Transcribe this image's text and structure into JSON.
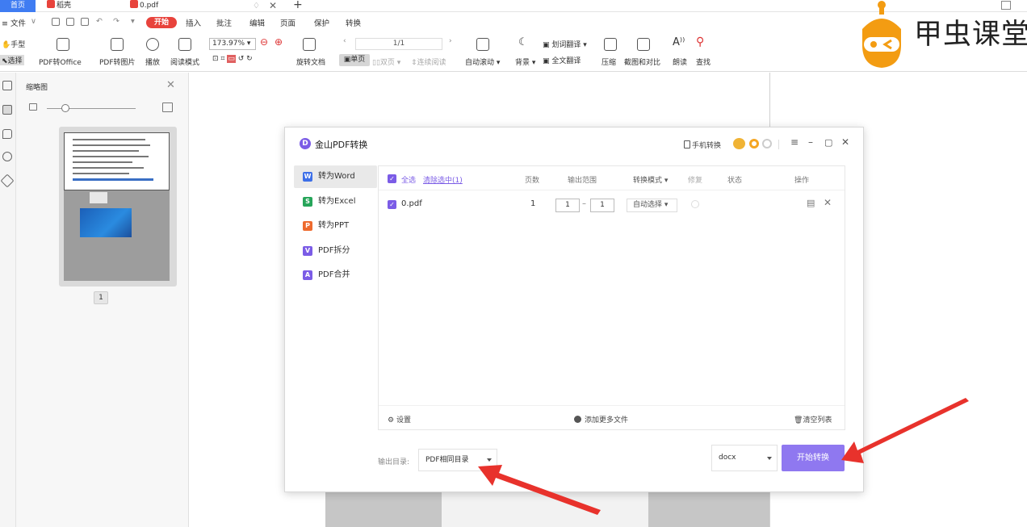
{
  "tabs": {
    "home": "首页",
    "daoke": "稻壳",
    "doc": "0.pdf"
  },
  "menu": {
    "file": "≡ 文件",
    "start": "开始",
    "items": [
      "插入",
      "批注",
      "编辑",
      "页面",
      "保护",
      "转换"
    ]
  },
  "ribbon": {
    "hand": "手型",
    "select": "选择",
    "pdf_to_office": "PDF转Office",
    "pdf_to_image": "PDF转图片",
    "play": "播放",
    "read_mode": "阅读模式",
    "zoom": "173.97%",
    "rotate": "旋转文档",
    "page_indicator": "1/1",
    "single_page": "单页",
    "double_page": "双页",
    "continuous": "连续阅读",
    "auto_scroll": "自动滚动",
    "background": "背景",
    "word_translate": "划词翻译",
    "full_translate": "全文翻译",
    "compress": "压缩",
    "screenshot_compare": "截图和对比",
    "read_aloud": "朗读",
    "find": "查找"
  },
  "logo": {
    "text": "甲虫课堂"
  },
  "thumbnail": {
    "title": "缩略图",
    "page_number": "1"
  },
  "dialog": {
    "title": "金山PDF转换",
    "phone_convert": "手机转换",
    "sidebar": [
      {
        "label": "转为Word",
        "icon": "W",
        "color": "#3d6fe8"
      },
      {
        "label": "转为Excel",
        "icon": "S",
        "color": "#27a55a"
      },
      {
        "label": "转为PPT",
        "icon": "P",
        "color": "#ee6a2e"
      },
      {
        "label": "PDF拆分",
        "icon": "V",
        "color": "#7b5ce6"
      },
      {
        "label": "PDF合并",
        "icon": "A",
        "color": "#7b5ce6"
      }
    ],
    "table": {
      "select_all": "全选",
      "clear_selected": "清除选中(1)",
      "headers": {
        "pages": "页数",
        "range": "输出范围",
        "mode": "转换模式 ▾",
        "repair": "修复",
        "status": "状态",
        "action": "操作"
      },
      "rows": [
        {
          "name": "0.pdf",
          "pages": "1",
          "range_from": "1",
          "range_to": "1",
          "mode": "自动选择 ▾"
        }
      ]
    },
    "footer": {
      "settings": "设置",
      "add_more": "添加更多文件",
      "clear_list": "清空列表"
    },
    "output_dir_label": "输出目录:",
    "output_dir_value": "PDF相同目录",
    "format_value": "docx",
    "start_button": "开始转换"
  },
  "colors": {
    "accent": "#7b5ce6",
    "start_button": "#8f78f0",
    "home_tab": "#3f7cf2",
    "start_menu": "#e8433c",
    "arrow": "#e8322c"
  }
}
